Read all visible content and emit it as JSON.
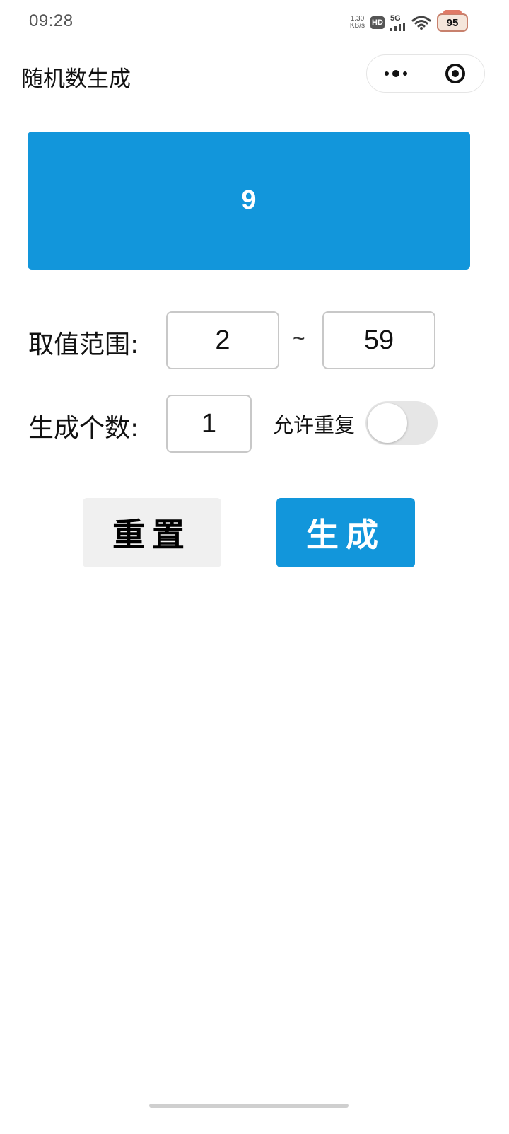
{
  "status_bar": {
    "time": "09:28",
    "net_speed_value": "1.30",
    "net_speed_unit": "KB/s",
    "hd_label": "HD",
    "signal_label": "5G",
    "battery_level": "95"
  },
  "header": {
    "title": "随机数生成"
  },
  "result": {
    "value": "9"
  },
  "range": {
    "label": "取值范围:",
    "min_value": "2",
    "separator": "~",
    "max_value": "59"
  },
  "count": {
    "label": "生成个数:",
    "value": "1"
  },
  "allow_repeat": {
    "label": "允许重复",
    "enabled": false
  },
  "buttons": {
    "reset_label": "重置",
    "generate_label": "生成"
  },
  "colors": {
    "accent": "#1296db",
    "reset_bg": "#f0f0f0",
    "toggle_off": "#e6e6e6"
  }
}
